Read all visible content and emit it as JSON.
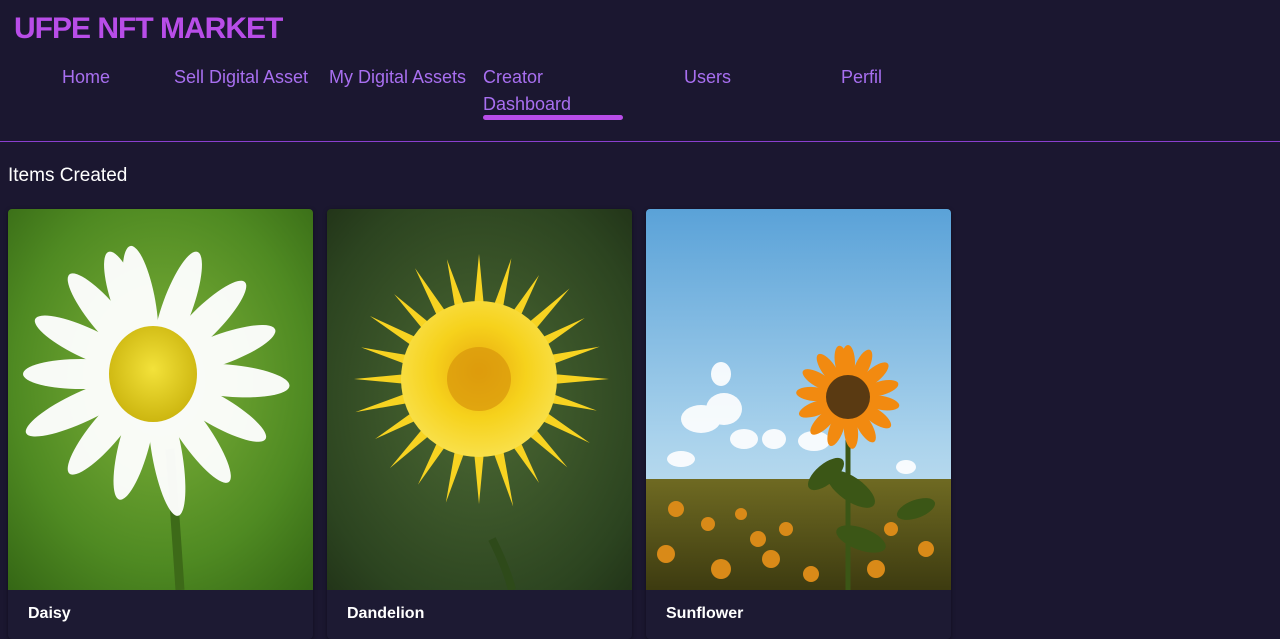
{
  "brand": {
    "title": "UFPE NFT MARKET",
    "color": "#b84de8"
  },
  "nav": {
    "items": [
      {
        "label": "Home"
      },
      {
        "label": "Sell Digital Asset"
      },
      {
        "label": "My Digital Assets"
      },
      {
        "label": "Creator Dashboard",
        "active": true
      },
      {
        "label": "Users"
      },
      {
        "label": "Perfil"
      }
    ],
    "link_color": "#a86ff0",
    "active_indicator_color": "#b84de8"
  },
  "main": {
    "section_title": "Items Created",
    "items": [
      {
        "name": "Daisy",
        "image": "daisy-photo"
      },
      {
        "name": "Dandelion",
        "image": "dandelion-photo"
      },
      {
        "name": "Sunflower",
        "image": "sunflower-field-photo"
      }
    ]
  },
  "colors": {
    "background": "#1b1730",
    "card": "#1d1a33"
  }
}
